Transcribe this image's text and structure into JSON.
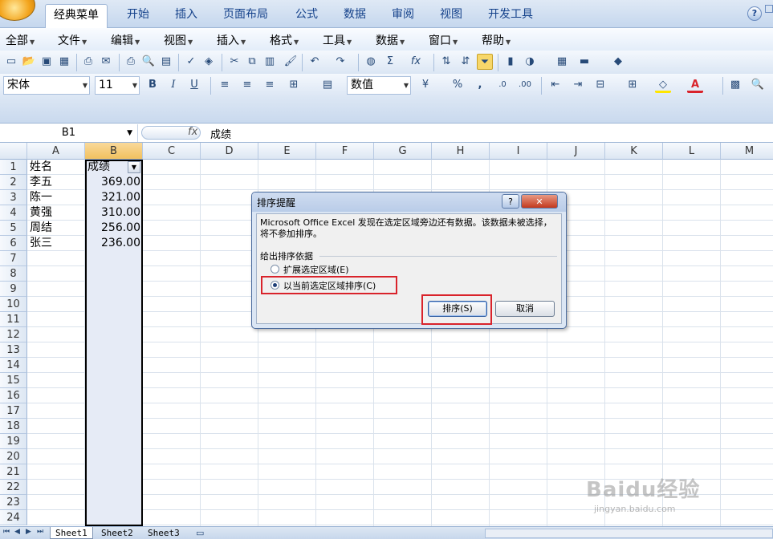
{
  "ribbon": {
    "tabs": [
      "经典菜单",
      "开始",
      "插入",
      "页面布局",
      "公式",
      "数据",
      "审阅",
      "视图",
      "开发工具"
    ],
    "active_tab": 0
  },
  "menubar": {
    "items": [
      "全部",
      "文件",
      "编辑",
      "视图",
      "插入",
      "格式",
      "工具",
      "数据",
      "窗口",
      "帮助"
    ]
  },
  "toolbar": {
    "font_name": "宋体",
    "font_size": "11",
    "bold_label": "B",
    "italic_label": "I",
    "underline_label": "U",
    "number_format": "数值",
    "sum_label": "Σ",
    "fx_label": "fx",
    "percent_label": "%",
    "comma_label": ","
  },
  "formula_bar": {
    "name_box": "B1",
    "fx_symbol": "fx",
    "content": "成绩"
  },
  "grid": {
    "columns": [
      "A",
      "B",
      "C",
      "D",
      "E",
      "F",
      "G",
      "H",
      "I",
      "J",
      "K",
      "L",
      "M"
    ],
    "selected_column": "B",
    "row_numbers": [
      "1",
      "2",
      "3",
      "4",
      "5",
      "6",
      "7",
      "8",
      "9",
      "10",
      "11",
      "12",
      "13",
      "14",
      "15",
      "16",
      "17",
      "18",
      "19",
      "20",
      "21",
      "22",
      "23",
      "24"
    ],
    "rows": [
      {
        "name": "姓名",
        "score": "成绩"
      },
      {
        "name": "李五",
        "score": "369.00"
      },
      {
        "name": "陈一",
        "score": "321.00"
      },
      {
        "name": "黄强",
        "score": "310.00"
      },
      {
        "name": "周结",
        "score": "256.00"
      },
      {
        "name": "张三",
        "score": "236.00"
      }
    ]
  },
  "sheets": {
    "tabs": [
      "Sheet1",
      "Sheet2",
      "Sheet3"
    ],
    "active": 0
  },
  "dialog": {
    "title": "排序提醒",
    "help_label": "?",
    "close_label": "✕",
    "message": "Microsoft Office Excel 发现在选定区域旁边还有数据。该数据未被选择，将不参加排序。",
    "group_label": "给出排序依据",
    "option_expand": "扩展选定区域(E)",
    "option_current": "以当前选定区域排序(C)",
    "selected_option": "option_current",
    "sort_button": "排序(S)",
    "cancel_button": "取消"
  },
  "watermark": {
    "brand": "Baidu经验",
    "url": "jingyan.baidu.com"
  },
  "colors": {
    "highlight_red": "#d9232b",
    "selected_column_fill": "#e6ebf6",
    "ribbon_text": "#15428b"
  }
}
